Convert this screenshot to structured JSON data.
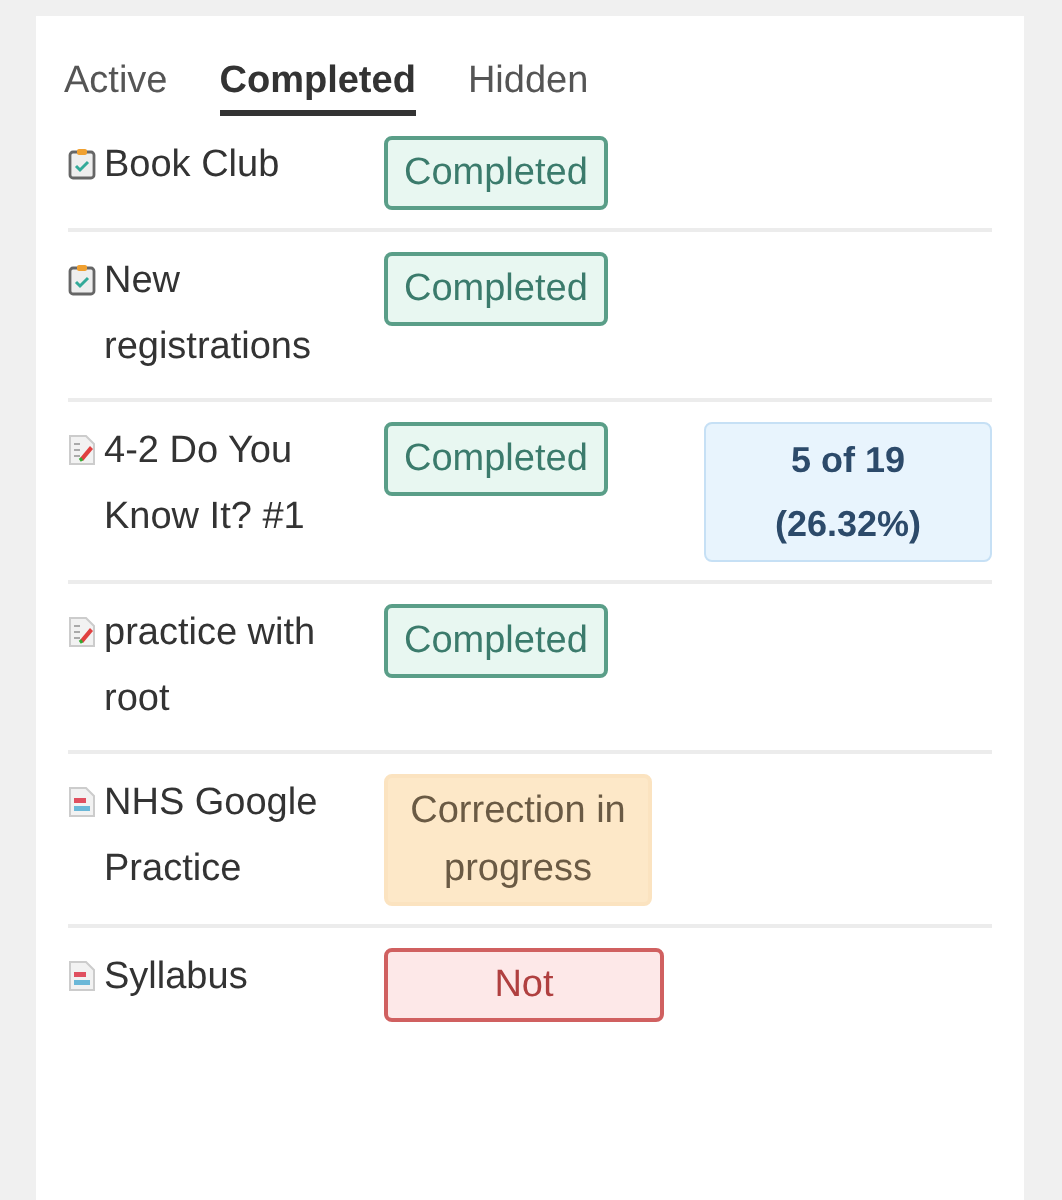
{
  "tabs": [
    {
      "label": "Active",
      "selected": false
    },
    {
      "label": "Completed",
      "selected": true
    },
    {
      "label": "Hidden",
      "selected": false
    }
  ],
  "rows": [
    {
      "kind": "clipboard",
      "name": "Book Club",
      "status": {
        "kind": "completed",
        "label": "Completed"
      }
    },
    {
      "kind": "clipboard",
      "name": "New registrations",
      "status": {
        "kind": "completed",
        "label": "Completed"
      }
    },
    {
      "kind": "quiz",
      "name": "4-2 Do You Know It? #1",
      "status": {
        "kind": "completed",
        "label": "Completed"
      },
      "score": "5 of 19 (26.32%)"
    },
    {
      "kind": "quiz",
      "name": "practice with root",
      "status": {
        "kind": "completed",
        "label": "Completed"
      }
    },
    {
      "kind": "document",
      "name": "NHS Google Practice",
      "status": {
        "kind": "in_progress",
        "label": "Correction in progress"
      }
    },
    {
      "kind": "document",
      "name": "Syllabus",
      "status": {
        "kind": "not_started",
        "label": "Not"
      }
    }
  ]
}
